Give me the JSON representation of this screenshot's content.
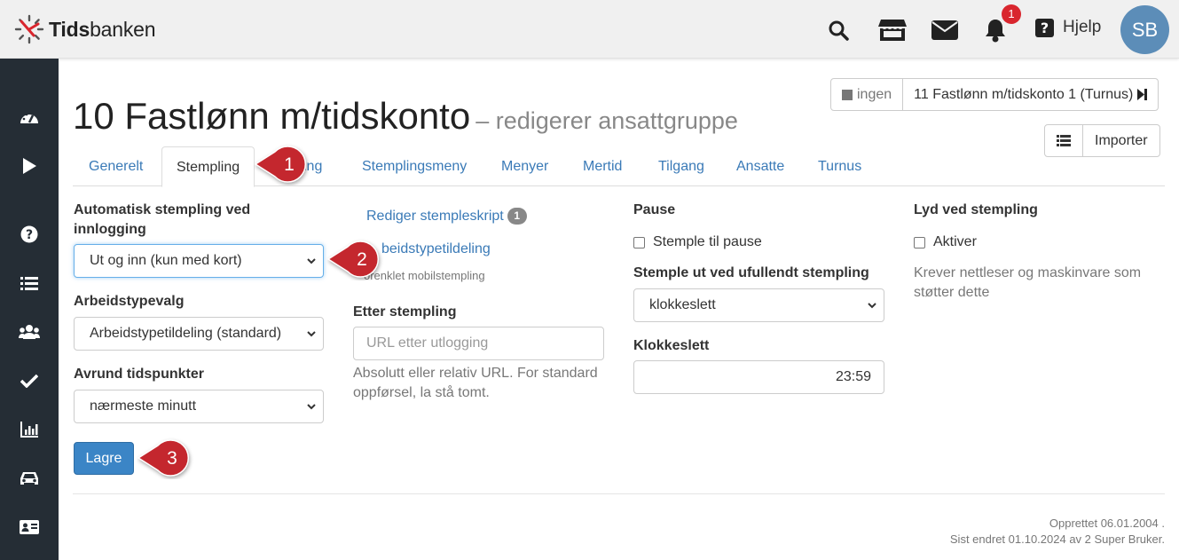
{
  "app": {
    "name_part1": "Tids",
    "name_part2": "banken",
    "help_label": "Hjelp",
    "avatar_initials": "SB",
    "notification_count": "1",
    "accent": "#3a7ab7",
    "sidebar_bg": "#252d35"
  },
  "topbar_icons": [
    "search-icon",
    "store-icon",
    "envelope-icon",
    "bell-icon",
    "question-icon"
  ],
  "sidebar_icons": [
    "dashboard-icon",
    "play-icon",
    "help-circle-icon",
    "list-icon",
    "users-icon",
    "check-icon",
    "chart-icon",
    "car-icon",
    "id-card-icon"
  ],
  "page": {
    "title": "10 Fastlønn m/tidskonto",
    "subtitle": "– redigerer ansattgruppe"
  },
  "nav": {
    "none_label": "ingen",
    "current_label": "11 Fastlønn m/tidskonto 1 (Turnus)",
    "import_label": "Importer"
  },
  "tabs": [
    {
      "label": "Generelt"
    },
    {
      "label": "Stempling"
    },
    {
      "label": "ing"
    },
    {
      "label": "Stemplingsmeny"
    },
    {
      "label": "Menyer"
    },
    {
      "label": "Mertid"
    },
    {
      "label": "Tilgang"
    },
    {
      "label": "Ansatte"
    },
    {
      "label": "Turnus"
    }
  ],
  "form": {
    "auto_label": "Automatisk stempling ved innlogging",
    "auto_value": "Ut og inn (kun med kort)",
    "worktype_label": "Arbeidstypevalg",
    "worktype_value": "Arbeidstypetildeling (standard)",
    "round_label": "Avrund tidspunkter",
    "round_value": "nærmeste minutt",
    "save_label": "Lagre",
    "script_link": "Rediger stempleskript",
    "script_count": "1",
    "worktype_link": "beidstypetildeling",
    "mobile_note": "orenklet mobilstempling",
    "after_label": "Etter stempling",
    "after_placeholder": "URL etter utlogging",
    "after_help": "Absolutt eller relativ URL. For standard oppførsel, la stå tomt.",
    "pause_label": "Pause",
    "pause_check": "Stemple til pause",
    "incomplete_label": "Stemple ut ved ufullendt stempling",
    "incomplete_value": "klokkeslett",
    "time_label": "Klokkeslett",
    "time_value": "23:59",
    "sound_label": "Lyd ved stempling",
    "sound_check": "Aktiver",
    "sound_help": "Krever nettleser og maskinvare som støtter dette"
  },
  "footer": {
    "created": "Opprettet 06.01.2004 .",
    "modified": "Sist endret 01.10.2024 av 2 Super Bruker."
  },
  "callouts": [
    "1",
    "2",
    "3"
  ],
  "callout_color": "#c4272e"
}
